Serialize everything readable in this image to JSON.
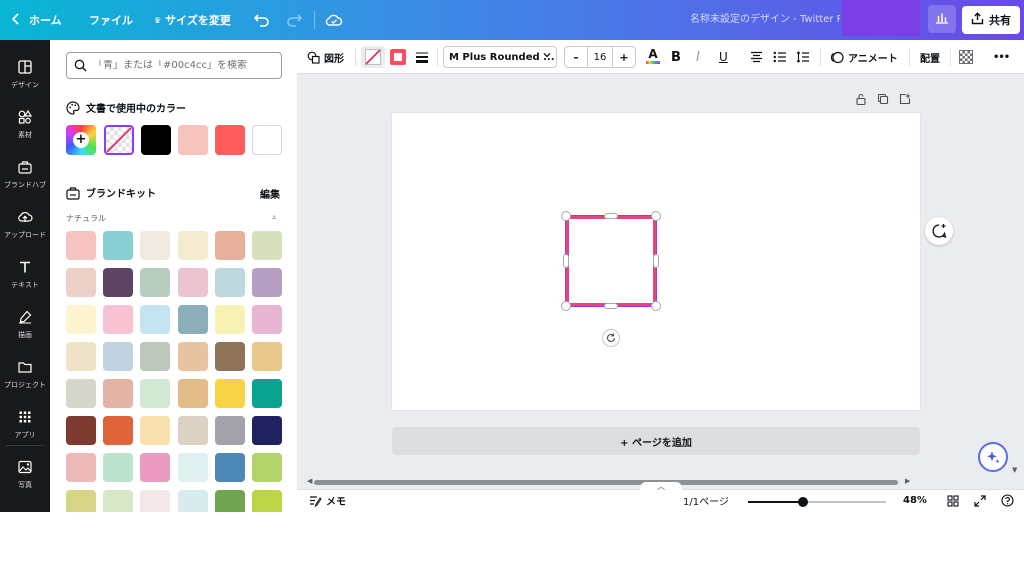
{
  "topbar": {
    "home_label": "ホーム",
    "file_label": "ファイル",
    "resize_label": "サイズを変更",
    "doc_title": "名称未設定のデザイン - Twitter Po",
    "share_label": "共有"
  },
  "rail": {
    "items": [
      {
        "label": "デザイン",
        "icon": "layout-icon"
      },
      {
        "label": "素材",
        "icon": "shapes-icon"
      },
      {
        "label": "ブランドハブ",
        "icon": "brand-icon"
      },
      {
        "label": "アップロード",
        "icon": "upload-icon"
      },
      {
        "label": "テキスト",
        "icon": "text-icon"
      },
      {
        "label": "描画",
        "icon": "draw-icon"
      },
      {
        "label": "プロジェクト",
        "icon": "folder-icon"
      },
      {
        "label": "アプリ",
        "icon": "apps-icon"
      },
      {
        "label": "写真",
        "icon": "photo-icon"
      }
    ]
  },
  "panel": {
    "search_placeholder": "「青」または「#00c4cc」を検索",
    "doc_colors_title": "文書で使用中のカラー",
    "doc_colors": [
      "#000000",
      "#f7c3bd",
      "#ff5c5c",
      "#ffffff"
    ],
    "brand_kit_title": "ブランドキット",
    "edit_label": "編集",
    "palette_name": "ナチュラル",
    "palette": [
      [
        "#f5c4c0",
        "#8acfd4",
        "#efebe1",
        "#f3ead0",
        "#e6b09b",
        "#d7e0be"
      ],
      [
        "#efd0c8",
        "#5e4464",
        "#b7cdbf",
        "#ebc4cf",
        "#bdd8dd",
        "#b49fc3"
      ],
      [
        "#fdf5cf",
        "#f7c3d3",
        "#c4e4f2",
        "#8caeb9",
        "#f7f2b4",
        "#e8b5d3"
      ],
      [
        "#efe3c7",
        "#c3d2df",
        "#bdc7bc",
        "#e7c49f",
        "#8e735a",
        "#e8c88c"
      ],
      [
        "#d7d6cb",
        "#e3b4a5",
        "#d2e8d3",
        "#e2bc88",
        "#f8d345",
        "#0aa38f"
      ],
      [
        "#7d3b30",
        "#e06439",
        "#f7e1ad",
        "#dcd2c3",
        "#a3a2ab",
        "#1f2160"
      ],
      [
        "#eebab8",
        "#bde2ce",
        "#eb9bc2",
        "#dff0f0",
        "#4d88b6",
        "#b1d36a"
      ],
      [
        "#d6d586",
        "#d6e8c5",
        "#f3e7e7",
        "#d8ecee",
        "#6fa550",
        "#bcd544"
      ]
    ]
  },
  "toolbar": {
    "shape_label": "図形",
    "font_name": "M Plus Rounded ...",
    "font_size": "16",
    "minus": "–",
    "plus": "+",
    "bold": "B",
    "italic": "I",
    "underline": "U",
    "animate_label": "アニメート",
    "arrange_label": "配置",
    "more": "•••"
  },
  "canvas": {
    "add_page_label": "+ ページを追加",
    "shape_border_color": "#e8457a"
  },
  "bottombar": {
    "notes_label": "メモ",
    "page_indicator": "1/1ページ",
    "zoom_level": "48%",
    "zoom_fraction": 0.4
  }
}
